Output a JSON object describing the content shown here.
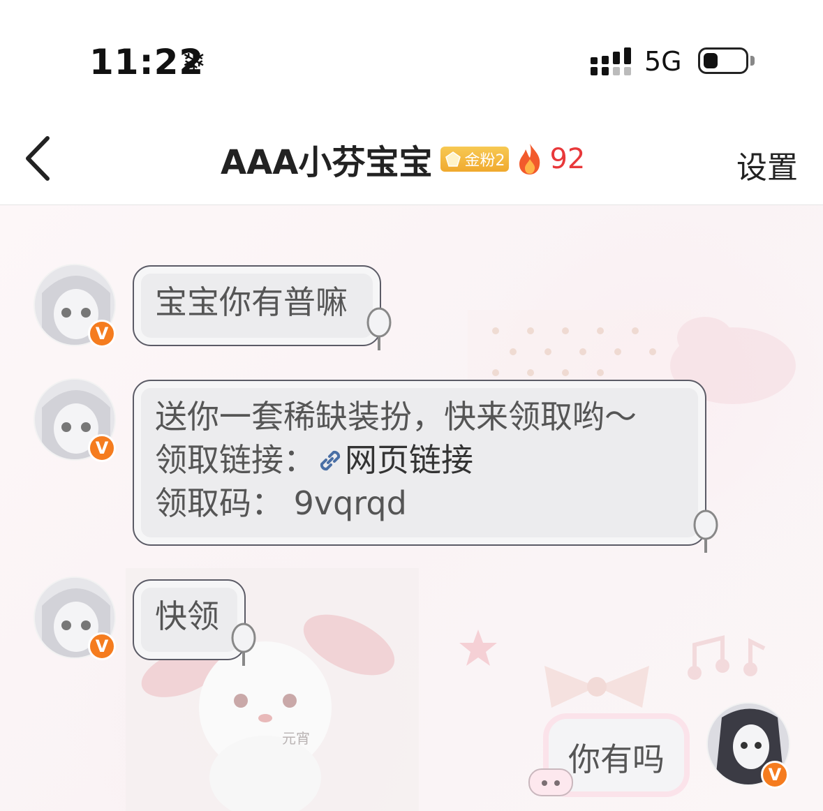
{
  "status_bar": {
    "time": "11:22",
    "network": "5G"
  },
  "nav": {
    "title": "AAA小芬宝宝",
    "fan_badge": "金粉2",
    "fire_count": "92",
    "settings_label": "设置"
  },
  "messages": [
    {
      "side": "left",
      "text": "宝宝你有普嘛"
    },
    {
      "side": "left",
      "line1": "送你一套稀缺装扮，快来领取哟～",
      "line2_label": "领取链接：",
      "line2_link": "网页链接",
      "line3": "领取码： 9vqrqd"
    },
    {
      "side": "left",
      "text": "快领"
    },
    {
      "side": "right",
      "text": "你有吗"
    }
  ],
  "watermark": "元宵",
  "colors": {
    "accent": "#f57c1f",
    "fire": "#e8383a",
    "badge": "#f0a92e",
    "link": "#4a6fa5"
  }
}
